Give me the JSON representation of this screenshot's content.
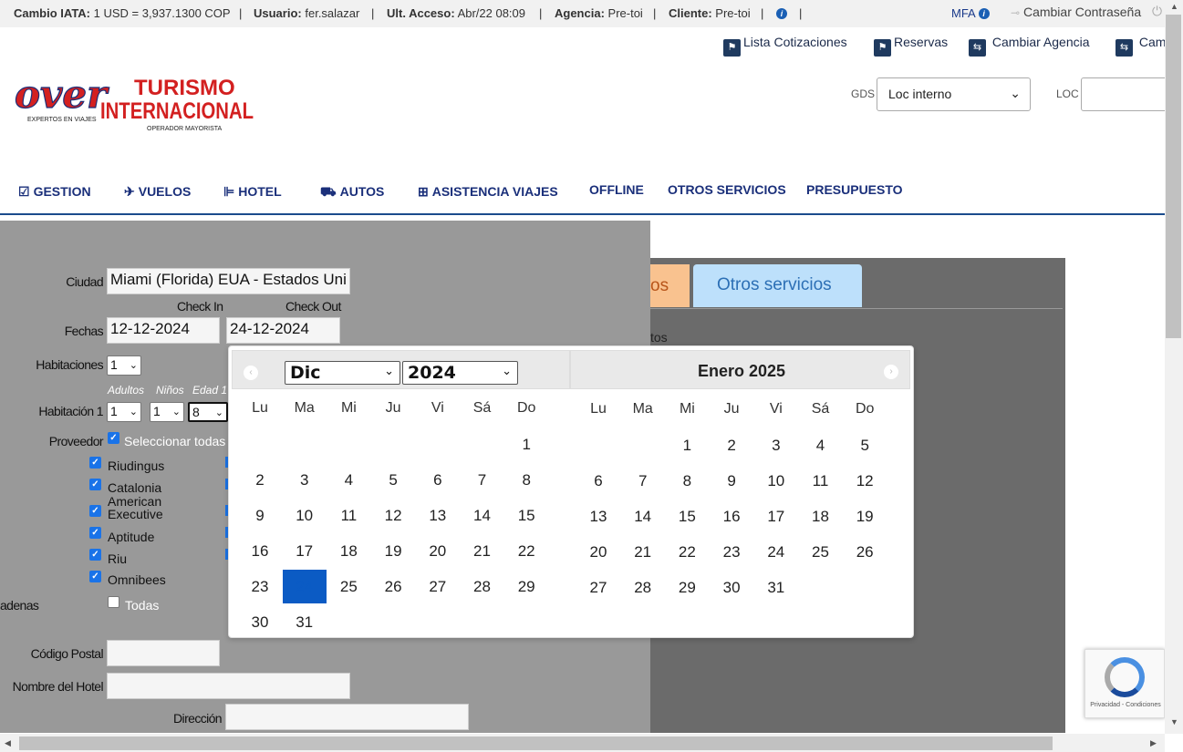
{
  "topbar": {
    "cambio_label": "Cambio IATA:",
    "cambio_value": "1 USD = 3,937.1300 COP",
    "usuario_label": "Usuario:",
    "usuario_value": "fer.salazar",
    "acceso_label": "Ult. Acceso:",
    "acceso_value": "Abr/22 08:09",
    "agencia_label": "Agencia:",
    "agencia_value": "Pre-toi",
    "cliente_label": "Cliente:",
    "cliente_value": "Pre-toi",
    "separator": "|",
    "mfa": "MFA",
    "cambiar_contrasena": "Cambiar Contraseña"
  },
  "links": {
    "lista_cotizaciones": "Lista Cotizaciones",
    "reservas": "Reservas",
    "cambiar_agencia": "Cambiar Agencia",
    "cambiar_cliente": "Cam"
  },
  "logo": {
    "over": "over",
    "tagline": "EXPERTOS EN VIAJES",
    "turismo": "TURISMO",
    "internacional": "INTERNACIONAL",
    "sub": "OPERADOR MAYORISTA"
  },
  "gds": {
    "label": "GDS",
    "value": "Loc interno",
    "loc_label": "LOC"
  },
  "nav": {
    "gestion": "GESTION",
    "vuelos": "VUELOS",
    "hotel": "HOTEL",
    "autos": "AUTOS",
    "asistencia": "ASISTENCIA VIAJES",
    "offline": "OFFLINE",
    "otros": "OTROS SERVICIOS",
    "presupuesto": "PRESUPUESTO"
  },
  "form": {
    "ciudad_label": "Ciudad",
    "ciudad_value": "Miami (Florida) EUA - Estados Uni",
    "checkin_label": "Check In",
    "checkout_label": "Check Out",
    "fechas_label": "Fechas",
    "checkin_value": "12-12-2024",
    "checkout_value": "24-12-2024",
    "habitaciones_label": "Habitaciones",
    "habitaciones_value": "1",
    "adultos_label": "Adultos",
    "ninos_label": "Niños",
    "edad_label": "Edad 1",
    "habitacion1_label": "Habitación 1",
    "adultos_value": "1",
    "ninos_value": "1",
    "edad_value": "8",
    "proveedor_label": "Proveedor",
    "seleccionar_todas": "Seleccionar todas",
    "providers": [
      "Riudingus",
      "Catalonia",
      "American Executive",
      "Aptitude",
      "Riu",
      "Omnibees"
    ],
    "cadenas_label": "adenas",
    "todas": "Todas",
    "codigo_postal_label": "Código Postal",
    "nombre_hotel_label": "Nombre del Hotel",
    "direccion_label": "Dirección"
  },
  "right": {
    "tab1": "os",
    "tab2": "Otros servicios",
    "partial_text": "tos"
  },
  "calendar": {
    "month_select": "Dic",
    "year_select": "2024",
    "second_title": "Enero 2025",
    "weekdays": [
      "Lu",
      "Ma",
      "Mi",
      "Ju",
      "Vi",
      "Sá",
      "Do"
    ],
    "selected_day": "24",
    "dec_days": [
      "1",
      "2",
      "3",
      "4",
      "5",
      "6",
      "7",
      "8",
      "9",
      "10",
      "11",
      "12",
      "13",
      "14",
      "15",
      "16",
      "17",
      "18",
      "19",
      "20",
      "21",
      "22",
      "23",
      "24",
      "25",
      "26",
      "27",
      "28",
      "29",
      "30",
      "31"
    ],
    "jan_days": [
      "1",
      "2",
      "3",
      "4",
      "5",
      "6",
      "7",
      "8",
      "9",
      "10",
      "11",
      "12",
      "13",
      "14",
      "15",
      "16",
      "17",
      "18",
      "19",
      "20",
      "21",
      "22",
      "23",
      "24",
      "25",
      "26",
      "27",
      "28",
      "29",
      "30",
      "31"
    ]
  },
  "recaptcha": {
    "text": "Privacidad - Condiciones"
  }
}
